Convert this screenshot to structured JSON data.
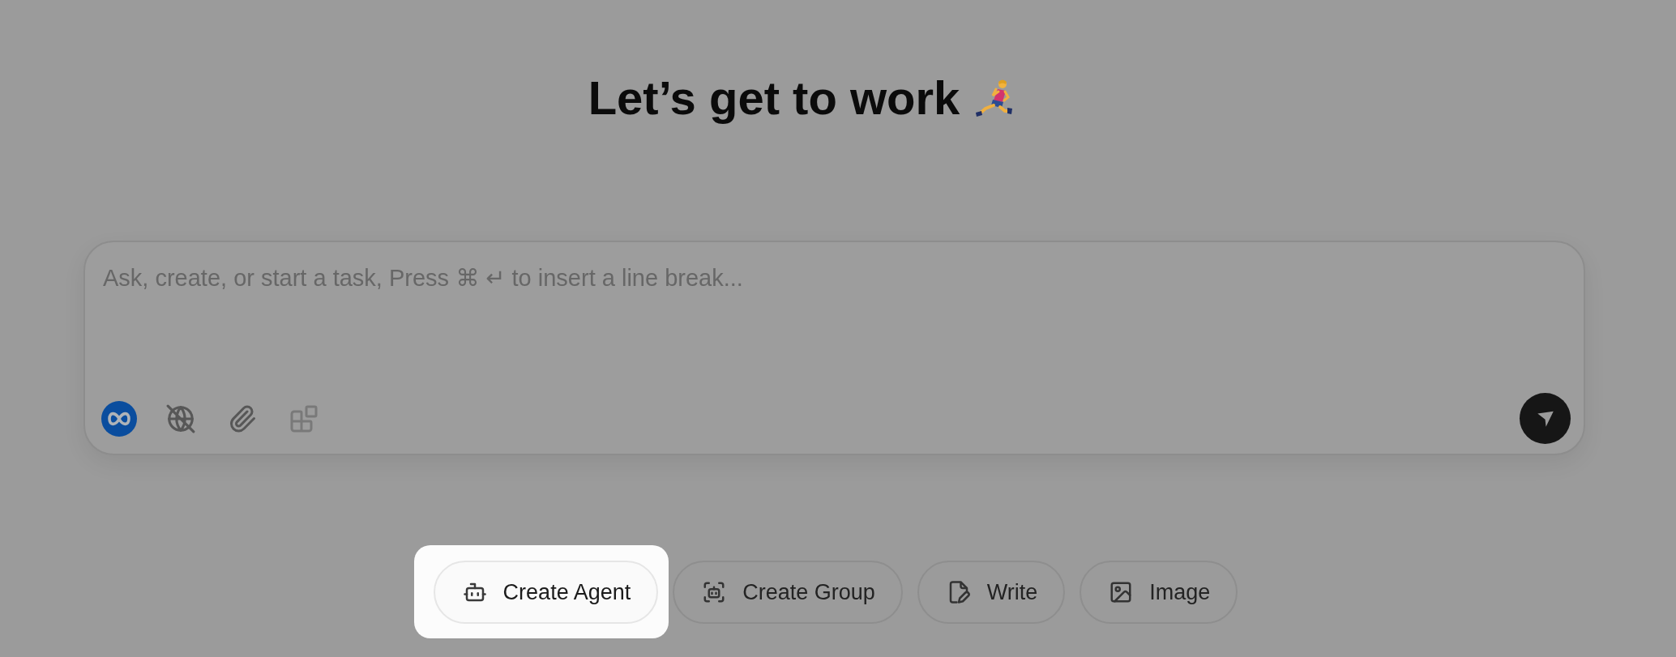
{
  "title": "Let’s get to work",
  "composer": {
    "placeholder": "Ask, create, or start a task, Press ⌘ ↵ to insert a line break...",
    "tools": [
      {
        "kind": "model",
        "disabled": false
      },
      {
        "kind": "web",
        "disabled": false
      },
      {
        "kind": "attach",
        "disabled": false
      },
      {
        "kind": "apps",
        "disabled": true
      }
    ]
  },
  "actions": [
    {
      "kind": "agent",
      "label": "Create Agent",
      "highlighted": true
    },
    {
      "kind": "group",
      "label": "Create Group",
      "highlighted": false
    },
    {
      "kind": "write",
      "label": "Write",
      "highlighted": false
    },
    {
      "kind": "image",
      "label": "Image",
      "highlighted": false
    }
  ]
}
